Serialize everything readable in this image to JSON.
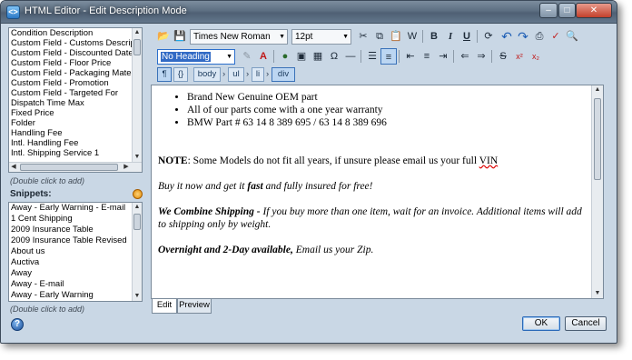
{
  "window": {
    "title": "HTML Editor - Edit Description Mode",
    "app_icon": "html-editor-icon",
    "controls": {
      "minimize": "–",
      "maximize": "□",
      "close": "✕"
    }
  },
  "fields": {
    "items": [
      "Condition Description",
      "Custom Field - Customs Descripti",
      "Custom Field - Discounted Date",
      "Custom Field - Floor Price",
      "Custom Field - Packaging Materia",
      "Custom Field - Promotion",
      "Custom Field - Targeted For",
      "Dispatch Time Max",
      "Fixed Price",
      "Folder",
      "Handling Fee",
      "Intl. Handling Fee",
      "Intl. Shipping Service 1"
    ],
    "hint": "(Double click to add)"
  },
  "snippets": {
    "label": "Snippets:",
    "items": [
      "Away - Early Warning - E-mail",
      "1 Cent Shipping",
      "2009 Insurance Table",
      "2009 Insurance Table Revised",
      "About us",
      "Auctiva",
      "Away",
      "Away - E-mail",
      "Away - Early Warning"
    ],
    "hint": "(Double click to add)"
  },
  "toolbar": {
    "font_family": "Times New Roman",
    "font_size": "12pt",
    "heading": "No Heading",
    "bold": "B",
    "italic": "I",
    "underline": "U",
    "strike": "S"
  },
  "breadcrumb": {
    "toggle": "¶",
    "code": "{}",
    "items": [
      "body",
      "ul",
      "li",
      "div"
    ]
  },
  "content": {
    "bullets": [
      "Brand New Genuine OEM part",
      "All of our parts come with a one year warranty",
      "BMW Part # 63 14 8 389 695 / 63 14 8 389 696"
    ],
    "note_label": "NOTE",
    "note_text": ": Some Models do not fit all years, if unsure please email us your full ",
    "note_vin": "VIN",
    "buy_pre": "Buy it now and get it ",
    "buy_fast": "fast",
    "buy_post": " and fully insured for free!",
    "combine_bold": "We Combine Shipping -",
    "combine_rest": " If you buy more than one item, wait for an invoice. Additional items will add to shipping only by weight.",
    "overnight_bold": "Overnight and 2-Day available,",
    "overnight_rest": " Email us your Zip."
  },
  "tabs": [
    "Edit",
    "Preview"
  ],
  "buttons": {
    "ok": "OK",
    "cancel": "Cancel"
  },
  "help_icon_label": "?"
}
